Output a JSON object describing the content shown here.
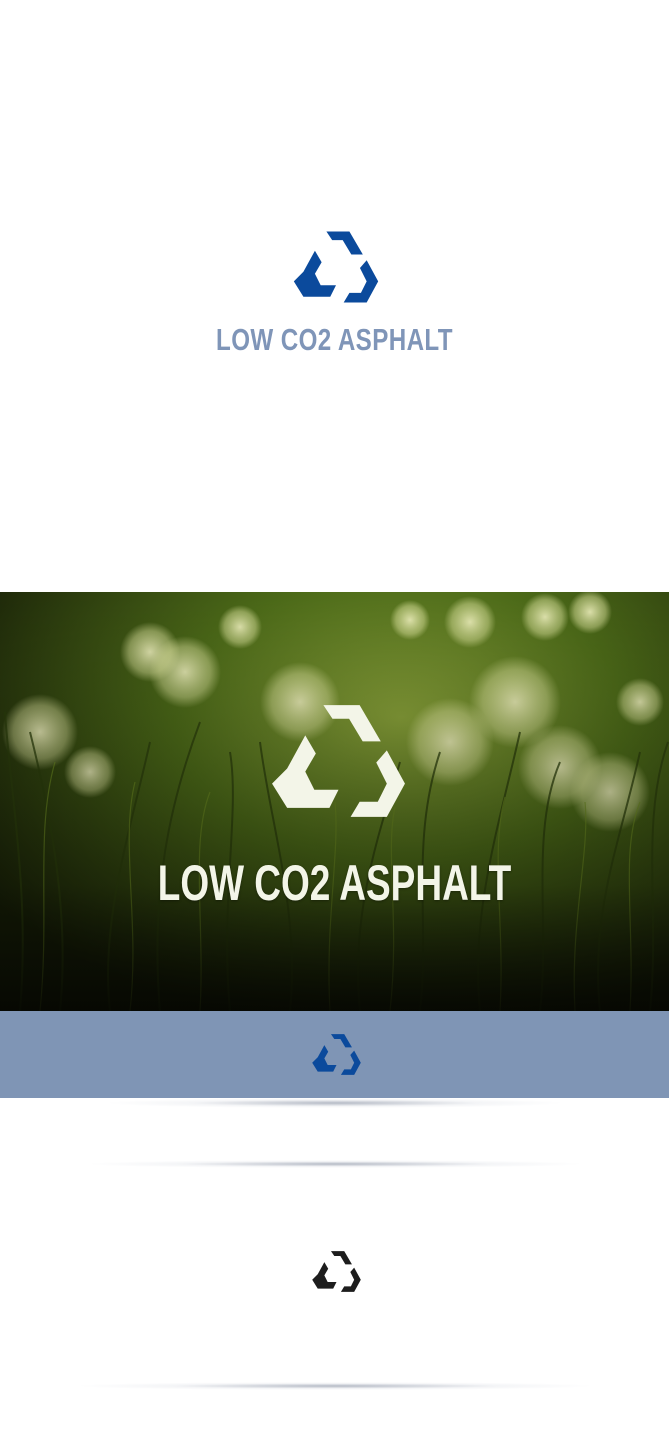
{
  "brand": {
    "name": "LOW CO2 ASPHALT",
    "colors": {
      "primary_blue": "#0b4a9c",
      "wordmark_blue": "#7f95b8",
      "bar_blue": "#7f95b5",
      "on_photo": "#f3f5e8",
      "mono": "#1d1d1d"
    }
  },
  "sections": {
    "logo_top": {
      "icon": "recycle-hexagon-icon"
    },
    "photo": {
      "icon": "recycle-hexagon-icon",
      "background": "grass-bokeh-photo"
    },
    "bar": {
      "icon": "recycle-hexagon-icon"
    },
    "mono": {
      "icon": "recycle-hexagon-icon"
    }
  }
}
